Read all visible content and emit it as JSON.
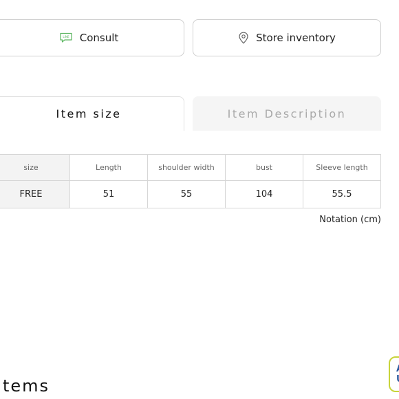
{
  "actions": {
    "consult_label": "Consult",
    "store_inventory_label": "Store inventory"
  },
  "tabs": [
    {
      "label": "Item size",
      "active": true
    },
    {
      "label": "Item Description",
      "active": false
    }
  ],
  "size_table": {
    "headers": [
      "size",
      "Length",
      "shoulder width",
      "bust",
      "Sleeve length"
    ],
    "rows": [
      [
        "FREE",
        "51",
        "55",
        "104",
        "55.5"
      ]
    ]
  },
  "notation": "Notation (cm)",
  "section_heading": "tems",
  "icons": {
    "consult": "line-chat-icon",
    "store_inventory": "location-pin-icon"
  },
  "colors": {
    "border": "#cfcfcf",
    "inactive_tab_bg": "#f5f5f5",
    "inactive_tab_text": "#a9a9a9",
    "line_green": "#5ab55f"
  }
}
